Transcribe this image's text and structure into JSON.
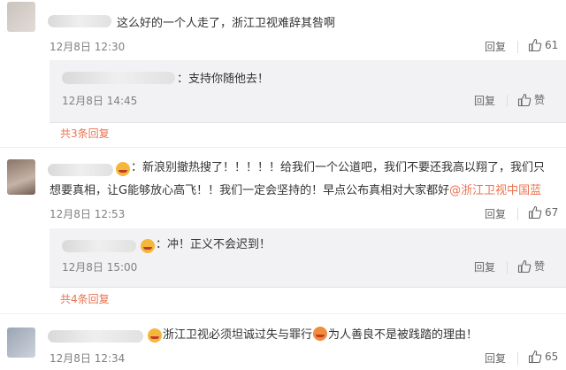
{
  "comments": [
    {
      "text": "这么好的一个人走了，浙江卫视难辞其咎啊",
      "time": "12月8日 12:30",
      "reply_label": "回复",
      "likes": "61"
    },
    {
      "text_before": "：新浪别撤热搜了！！！！！给我们一个公道吧，我们不要还我高以翔了，我们只",
      "text_line2": "想要真相，让G能够放心高飞！！我们一定会坚持的！早点公布真相对大家都好",
      "mention": "@浙江卫视中国蓝",
      "time": "12月8日 12:53",
      "reply_label": "回复",
      "likes": "67"
    },
    {
      "text_before": "浙江卫视必须坦诚过失与罪行",
      "text_after": "为人善良不是被践踏的理由！",
      "time": "12月8日 12:34",
      "reply_label": "回复",
      "likes": "65"
    }
  ],
  "replies": [
    {
      "text": "：支持你随他去！",
      "time": "12月8日 14:45",
      "reply_label": "回复",
      "like_label": "赞"
    },
    {
      "text": "：冲！正义不会迟到！",
      "time": "12月8日 15:00",
      "reply_label": "回复",
      "like_label": "赞"
    }
  ],
  "more_replies": [
    "共3条回复",
    "共4条回复"
  ],
  "colors": {
    "accent": "#eb7350",
    "sub_bg": "#f2f2f5",
    "time": "#808080"
  },
  "icons": [
    "thumbs-up-icon",
    "smiley-emoji-icon",
    "angry-emoji-icon"
  ]
}
